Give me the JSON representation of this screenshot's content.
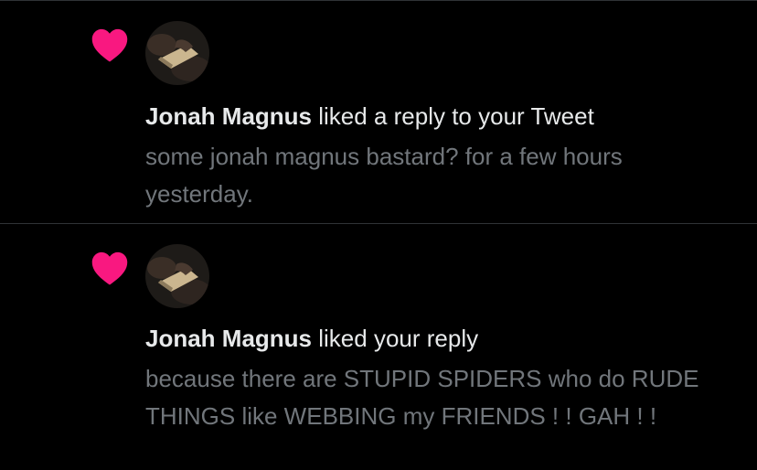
{
  "colors": {
    "background": "#000000",
    "heart": "#f91880",
    "primary_text": "#e7e9ea",
    "secondary_text": "#71767b",
    "divider": "#2f3336"
  },
  "notifications": [
    {
      "icon": "heart-icon",
      "avatar": "avatar",
      "user_name": "Jonah Magnus",
      "action": "liked a reply to your Tweet",
      "tweet_text": "some jonah magnus bastard? for a few hours yesterday."
    },
    {
      "icon": "heart-icon",
      "avatar": "avatar",
      "user_name": "Jonah Magnus",
      "action": "liked your reply",
      "tweet_text": "because there are STUPID SPIDERS who do RUDE THINGS like WEBBING my FRIENDS ! ! GAH ! !"
    }
  ]
}
